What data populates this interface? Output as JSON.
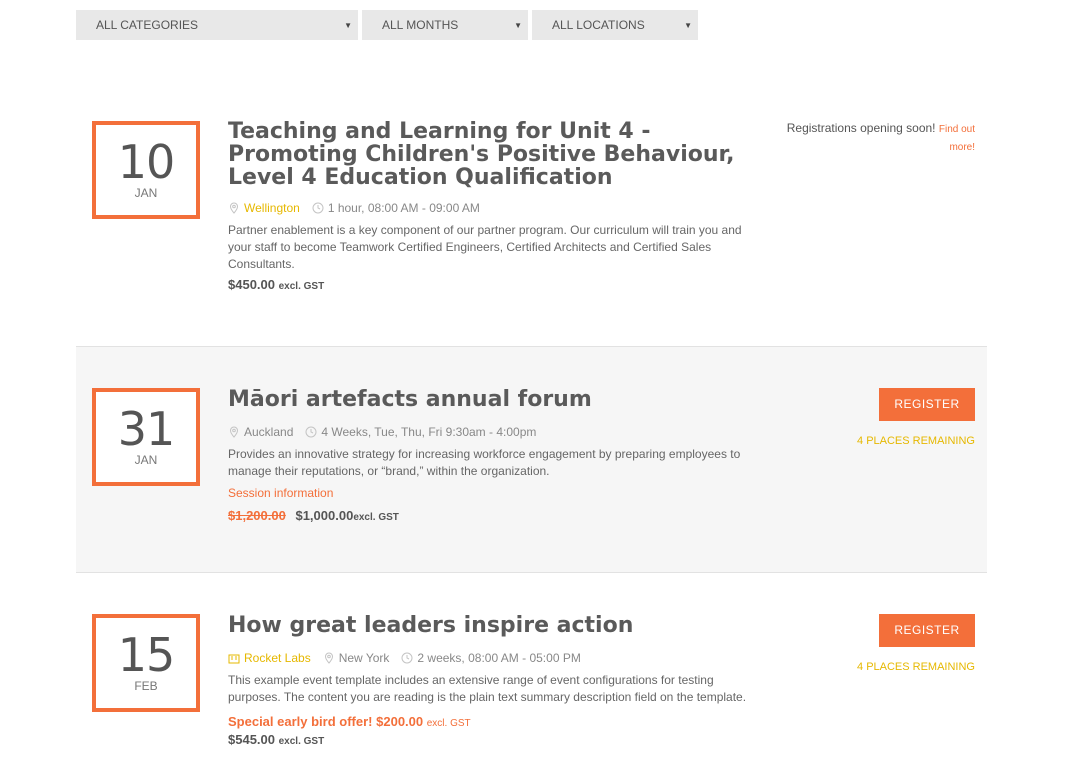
{
  "filters": {
    "categories": "ALL CATEGORIES",
    "months": "ALL MONTHS",
    "locations": "ALL LOCATIONS"
  },
  "events": [
    {
      "day": "10",
      "month": "JAN",
      "title": "Teaching and Learning for Unit 4 - Promoting Children's Positive Behaviour, Level 4 Education Qualification",
      "location": "Wellington",
      "time": "1 hour, 08:00 AM - 09:00 AM",
      "description": "Partner enablement is a key component of our partner program. Our curriculum will train you and your staff to become Teamwork Certified Engineers, Certified Architects and Certified Sales Consultants.",
      "price": "$450.00",
      "gst": "excl. GST",
      "registration_note": "Registrations opening soon!",
      "find_out_link": "Find out more!"
    },
    {
      "day": "31",
      "month": "JAN",
      "title": "Māori artefacts annual forum",
      "location": "Auckland",
      "time": "4 Weeks, Tue, Thu, Fri 9:30am - 4:00pm",
      "description": "Provides an innovative strategy for increasing workforce engagement by preparing employees to manage their reputations, or “brand,” within the organization.",
      "session_link": "Session information",
      "old_price": "$1,200.00",
      "price": "$1,000.00",
      "gst": "excl. GST",
      "register_label": "REGISTER",
      "places": "4 PLACES REMAINING"
    },
    {
      "day": "15",
      "month": "FEB",
      "title": "How great leaders inspire action",
      "venue": "Rocket Labs",
      "location": "New York",
      "time": "2 weeks, 08:00 AM - 05:00 PM",
      "description": "This example event template includes an extensive range of event configurations for testing purposes. The content you are reading is the plain text summary description field on the template.",
      "special_label": "Special early bird offer!",
      "special_price": "$200.00",
      "special_gst": "excl. GST",
      "price": "$545.00",
      "gst": "excl. GST",
      "register_label": "REGISTER",
      "places": "4 PLACES REMAINING"
    }
  ],
  "colors": {
    "accent": "#f36f3a",
    "highlight": "#e6b800"
  }
}
